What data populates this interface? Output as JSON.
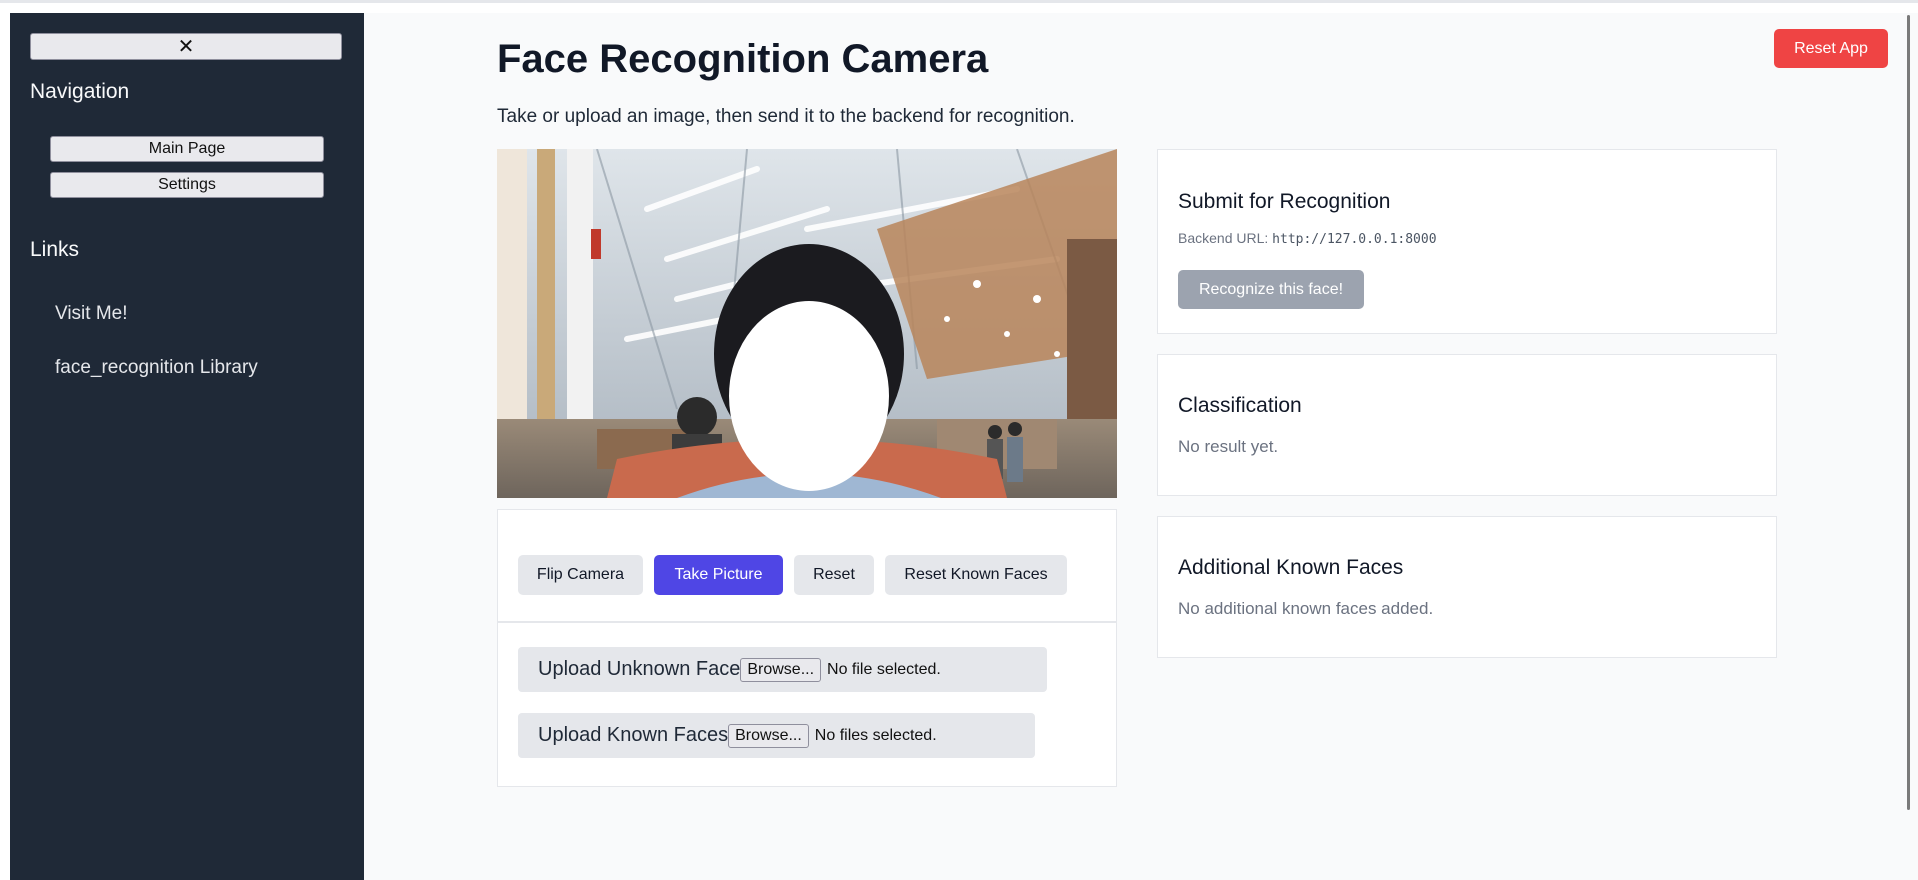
{
  "sidebar": {
    "close_glyph": "✕",
    "navigation_heading": "Navigation",
    "nav_items": [
      {
        "label": "Main Page"
      },
      {
        "label": "Settings"
      }
    ],
    "links_heading": "Links",
    "links": [
      {
        "label": "Visit Me!"
      },
      {
        "label": "face_recognition Library"
      }
    ]
  },
  "header": {
    "reset_app_label": "Reset App",
    "title": "Face Recognition Camera",
    "subtitle": "Take or upload an image, then send it to the backend for recognition."
  },
  "controls": {
    "buttons": [
      {
        "label": "Flip Camera"
      },
      {
        "label": "Take Picture"
      },
      {
        "label": "Reset"
      },
      {
        "label": "Reset Known Faces"
      }
    ],
    "upload_unknown": {
      "label": "Upload Unknown Face",
      "browse_label": "Browse...",
      "status": "No file selected."
    },
    "upload_known": {
      "label": "Upload Known Faces",
      "browse_label": "Browse...",
      "status": "No files selected."
    }
  },
  "submit_card": {
    "heading": "Submit for Recognition",
    "backend_label": "Backend URL:",
    "backend_url": "http://127.0.0.1:8000",
    "button_label": "Recognize this face!"
  },
  "classification_card": {
    "heading": "Classification",
    "result": "No result yet."
  },
  "known_faces_card": {
    "heading": "Additional Known Faces",
    "status": "No additional known faces added."
  },
  "colors": {
    "sidebar_bg": "#1f2937",
    "primary": "#4f46e5",
    "danger": "#ef4444",
    "disabled": "#9ca3af"
  }
}
